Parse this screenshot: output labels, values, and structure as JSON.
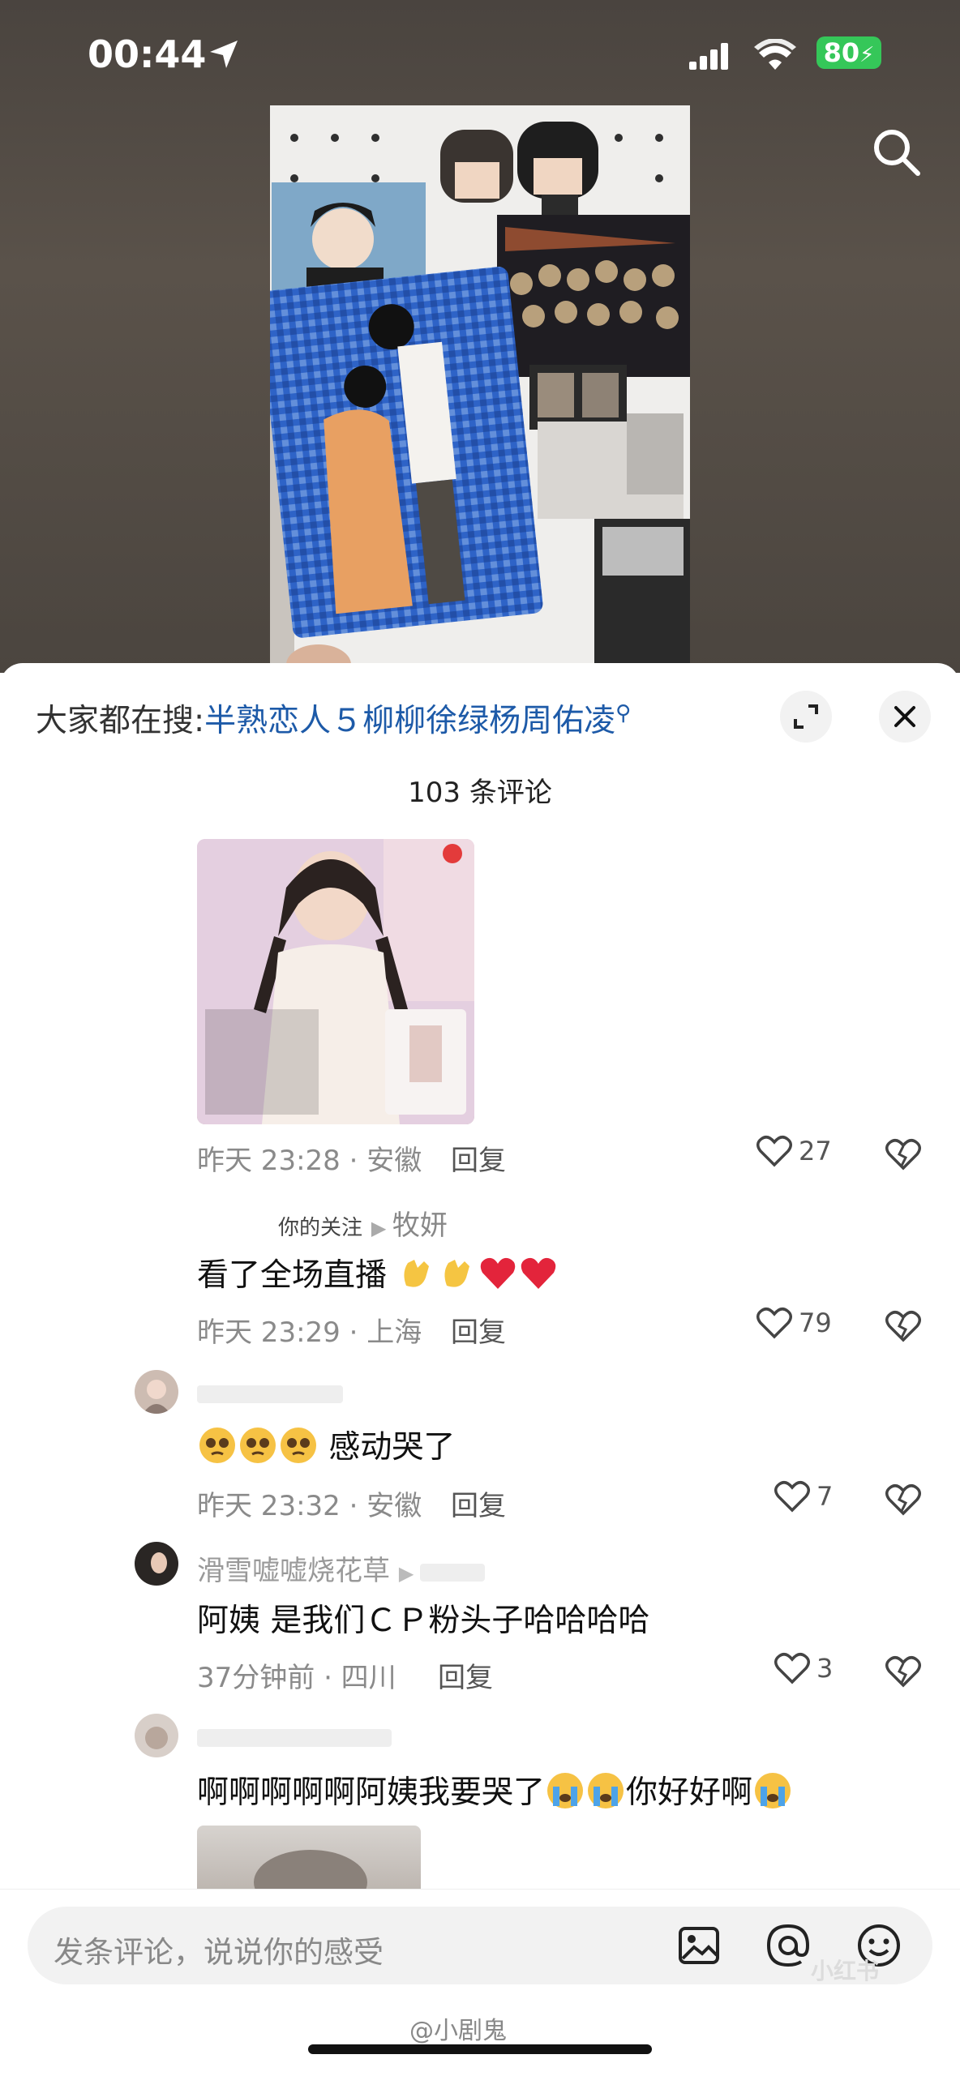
{
  "status_bar": {
    "time": "00:44",
    "battery": "80"
  },
  "search_bar": {
    "prefix": "大家都在搜:",
    "query": "半熟恋人５柳柳徐绿杨周佑凌"
  },
  "comments_header": {
    "count_text": "103 条评论"
  },
  "comments": [
    {
      "meta": "昨天 23:28 · 安徽",
      "reply": "回复",
      "likes": "27"
    },
    {
      "author_tag": "你的关注",
      "author": "牧妍",
      "text": "看了全场直播",
      "meta": "昨天 23:29 · 上海",
      "reply": "回复",
      "likes": "79"
    },
    {
      "author": "",
      "text": "感动哭了",
      "meta": "昨天 23:32 · 安徽",
      "reply": "回复",
      "likes": "7"
    },
    {
      "author": "滑雪嘘嘘烧花草",
      "text": "阿姨 是我们ＣＰ粉头子哈哈哈哈",
      "meta": "37分钟前 · 四川",
      "reply": "回复",
      "likes": "3"
    },
    {
      "author": "",
      "text": "啊啊啊啊啊阿姨我要哭了",
      "text2": "你好好啊"
    }
  ],
  "composer": {
    "placeholder": "发条评论，说说你的感受"
  },
  "watermarks": {
    "bottom": "@小剧鬼",
    "corner": "小红书"
  },
  "colors": {
    "link": "#1d5aa8",
    "battery": "#35c759"
  }
}
